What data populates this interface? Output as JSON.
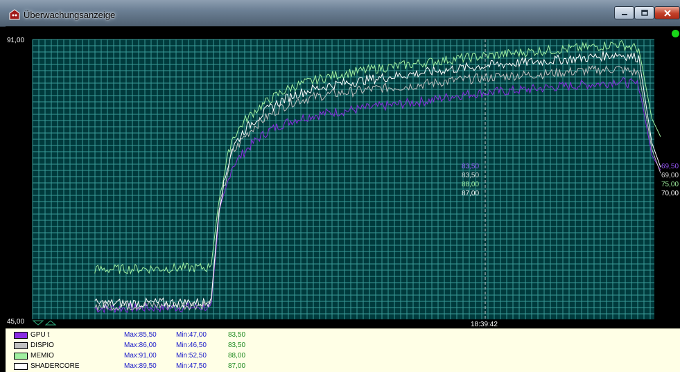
{
  "window": {
    "title": "Überwachungsanzeige"
  },
  "chart_data": {
    "type": "line",
    "ylim": [
      45,
      91
    ],
    "y_max_label": "91,00",
    "y_min_label": "45,00",
    "grid": true,
    "cursor_time": "18:39:42",
    "series": [
      {
        "name": "GPU t",
        "color": "#8a2be2",
        "max": "Max:85,50",
        "min": "Min:47,00",
        "current": "83,50",
        "cursor_value": "83,50",
        "end_value": "69,50",
        "points": [
          [
            0.1,
            46.8
          ],
          [
            0.28,
            47.0
          ],
          [
            0.287,
            47.2
          ],
          [
            0.3,
            62
          ],
          [
            0.32,
            70
          ],
          [
            0.34,
            72.5
          ],
          [
            0.36,
            74.5
          ],
          [
            0.38,
            76
          ],
          [
            0.4,
            77
          ],
          [
            0.42,
            77.8
          ],
          [
            0.45,
            78.5
          ],
          [
            0.48,
            79
          ],
          [
            0.52,
            79.5
          ],
          [
            0.56,
            80
          ],
          [
            0.6,
            80.5
          ],
          [
            0.64,
            81
          ],
          [
            0.68,
            81.8
          ],
          [
            0.72,
            82.2
          ],
          [
            0.76,
            82.5
          ],
          [
            0.8,
            82.8
          ],
          [
            0.84,
            83.2
          ],
          [
            0.88,
            83.5
          ],
          [
            0.92,
            83.8
          ],
          [
            0.94,
            84.2
          ],
          [
            0.975,
            83.5
          ],
          [
            0.99,
            72
          ],
          [
            1.0,
            69.5
          ]
        ]
      },
      {
        "name": "DISPIO",
        "color": "#c0c0c0",
        "max": "Max:86,00",
        "min": "Min:46,50",
        "current": "83,50",
        "cursor_value": "83,50",
        "end_value": "69,00",
        "points": [
          [
            0.1,
            47.2
          ],
          [
            0.28,
            47.4
          ],
          [
            0.287,
            47.6
          ],
          [
            0.3,
            63
          ],
          [
            0.32,
            72
          ],
          [
            0.34,
            75
          ],
          [
            0.36,
            77
          ],
          [
            0.38,
            78.5
          ],
          [
            0.4,
            79.8
          ],
          [
            0.42,
            80.8
          ],
          [
            0.45,
            81.5
          ],
          [
            0.48,
            82
          ],
          [
            0.52,
            82.5
          ],
          [
            0.56,
            83
          ],
          [
            0.6,
            83.3
          ],
          [
            0.64,
            83.8
          ],
          [
            0.68,
            84.3
          ],
          [
            0.72,
            84.6
          ],
          [
            0.76,
            85
          ],
          [
            0.8,
            85.2
          ],
          [
            0.84,
            85.5
          ],
          [
            0.88,
            85.8
          ],
          [
            0.92,
            86
          ],
          [
            0.94,
            86.2
          ],
          [
            0.975,
            85.5
          ],
          [
            0.99,
            73
          ],
          [
            1.0,
            69.0
          ]
        ]
      },
      {
        "name": "MEMIO",
        "color": "#a0f0a0",
        "max": "Max:91,00",
        "min": "Min:52,50",
        "current": "88,00",
        "cursor_value": "88,00",
        "end_value": "75,00",
        "points": [
          [
            0.1,
            53.2
          ],
          [
            0.28,
            53.5
          ],
          [
            0.287,
            53.6
          ],
          [
            0.3,
            65
          ],
          [
            0.32,
            74.5
          ],
          [
            0.34,
            77.5
          ],
          [
            0.36,
            79.5
          ],
          [
            0.38,
            81
          ],
          [
            0.4,
            82.3
          ],
          [
            0.42,
            83.3
          ],
          [
            0.45,
            84.2
          ],
          [
            0.48,
            85
          ],
          [
            0.52,
            85.7
          ],
          [
            0.56,
            86.3
          ],
          [
            0.6,
            86.8
          ],
          [
            0.64,
            87.3
          ],
          [
            0.68,
            87.8
          ],
          [
            0.72,
            88.2
          ],
          [
            0.76,
            88.6
          ],
          [
            0.8,
            89
          ],
          [
            0.84,
            89.3
          ],
          [
            0.88,
            89.6
          ],
          [
            0.92,
            90
          ],
          [
            0.94,
            90.3
          ],
          [
            0.975,
            89.5
          ],
          [
            0.99,
            78
          ],
          [
            1.0,
            75.0
          ]
        ]
      },
      {
        "name": "SHADERCORE",
        "color": "#ffffff",
        "max": "Max:89,50",
        "min": "Min:47,50",
        "current": "87,00",
        "cursor_value": "87,00",
        "end_value": "70,00",
        "points": [
          [
            0.1,
            47.6
          ],
          [
            0.28,
            47.8
          ],
          [
            0.287,
            48
          ],
          [
            0.3,
            63.5
          ],
          [
            0.32,
            73
          ],
          [
            0.34,
            76
          ],
          [
            0.36,
            78
          ],
          [
            0.38,
            79.6
          ],
          [
            0.4,
            80.9
          ],
          [
            0.42,
            81.9
          ],
          [
            0.45,
            82.8
          ],
          [
            0.48,
            83.5
          ],
          [
            0.52,
            84.1
          ],
          [
            0.56,
            84.7
          ],
          [
            0.6,
            85.2
          ],
          [
            0.64,
            85.7
          ],
          [
            0.68,
            86.2
          ],
          [
            0.72,
            86.6
          ],
          [
            0.76,
            87
          ],
          [
            0.8,
            87.3
          ],
          [
            0.84,
            87.6
          ],
          [
            0.88,
            87.9
          ],
          [
            0.92,
            88.3
          ],
          [
            0.94,
            88.6
          ],
          [
            0.975,
            88
          ],
          [
            0.99,
            74
          ],
          [
            1.0,
            70.0
          ]
        ]
      }
    ]
  }
}
